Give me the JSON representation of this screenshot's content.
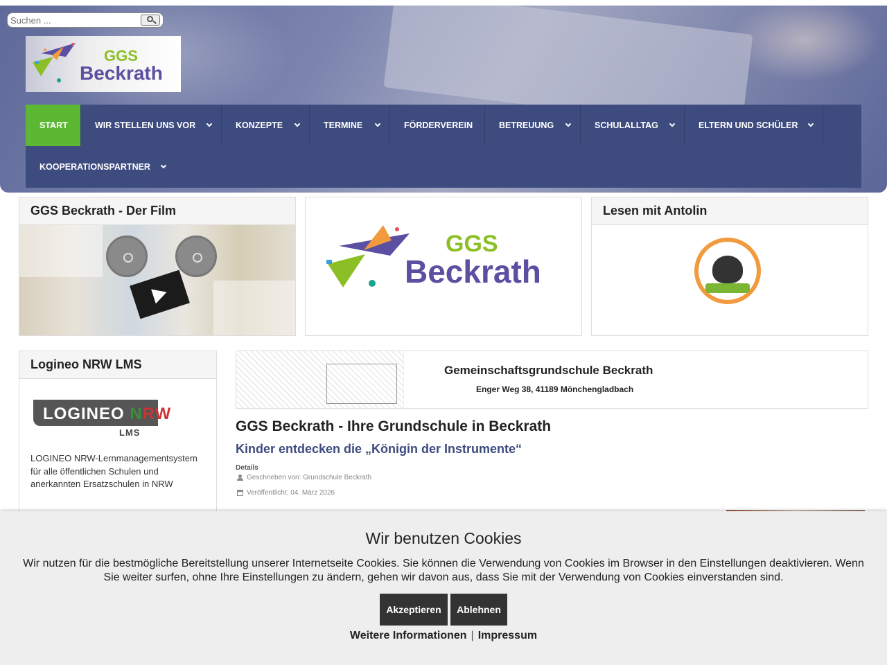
{
  "search": {
    "placeholder": "Suchen ..."
  },
  "brand": {
    "ggs": "GGS",
    "name": "Beckrath"
  },
  "nav": {
    "items": [
      {
        "label": "Start"
      },
      {
        "label": "Wir stellen uns vor"
      },
      {
        "label": "Konzepte"
      },
      {
        "label": "Termine"
      },
      {
        "label": "Förderverein"
      },
      {
        "label": "Betreuung"
      },
      {
        "label": "Schulalltag"
      },
      {
        "label": "Eltern und Schüler"
      },
      {
        "label": "Kooperationspartner"
      }
    ],
    "active_color": "#5cb832",
    "bar_color": "#3d4b7f"
  },
  "cards": {
    "film": {
      "title": "GGS Beckrath - Der Film"
    },
    "logo": {
      "ggs": "GGS",
      "name": "Beckrath"
    },
    "antolin": {
      "title": "Lesen mit Antolin"
    },
    "logineo": {
      "title": "Logineo NRW LMS",
      "logo_word": "LOGINEO",
      "logo_n": "N",
      "logo_r": "R",
      "logo_w": "W",
      "logo_lms": "LMS",
      "description": "LOGINEO NRW-Lernmanagementsystem für alle öffentlichen Schulen und anerkannten Ersatzschulen in NRW"
    }
  },
  "school": {
    "name": "Gemeinschaftsgrundschule Beckrath",
    "address": "Enger Weg 38, 41189 Mönchengladbach"
  },
  "article": {
    "page_title": "GGS Beckrath - Ihre Grundschule in Beckrath",
    "title": "Kinder entdecken die „Königin der Instrumente“",
    "details_label": "Details",
    "author": "Geschrieben von: Grundschule Beckrath",
    "published": "Veröffentlicht: 04. März 2026"
  },
  "cookie": {
    "title": "Wir benutzen Cookies",
    "text": "Wir nutzen für die bestmögliche Bereitstellung unserer Internetseite Cookies. Sie können die Verwendung von Cookies im Browser in den Einstellungen deaktivieren. Wenn Sie weiter surfen, ohne Ihre Einstellungen zu ändern, gehen wir davon aus, dass Sie mit der Verwendung von Cookies einverstanden sind.",
    "accept": "Akzeptieren",
    "decline": "Ablehnen",
    "more_info": "Weitere Informationen",
    "separator": "|",
    "imprint": "Impressum"
  }
}
